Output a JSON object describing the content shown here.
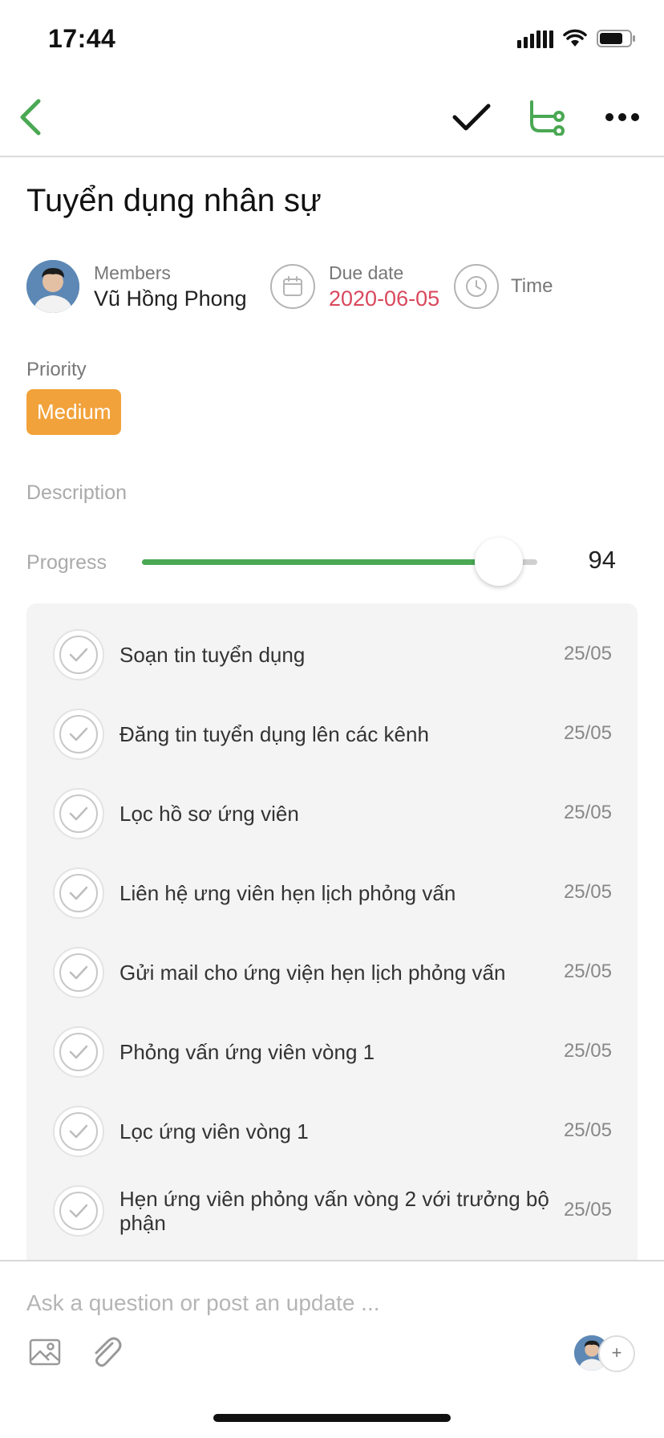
{
  "status_bar": {
    "time": "17:44"
  },
  "task": {
    "title": "Tuyển dụng nhân sự",
    "members_label": "Members",
    "member_name": "Vũ Hồng Phong",
    "due_label": "Due date",
    "due_value": "2020-06-05",
    "time_label": "Time",
    "priority_label": "Priority",
    "priority_value": "Medium",
    "description_label": "Description",
    "progress_label": "Progress",
    "progress_value": 94
  },
  "checklist": [
    {
      "text": "Soạn tin tuyển dụng",
      "date": "25/05"
    },
    {
      "text": "Đăng tin tuyển dụng lên các kênh",
      "date": "25/05"
    },
    {
      "text": "Lọc hồ sơ ứng viên",
      "date": "25/05"
    },
    {
      "text": "Liên hệ ưng viên hẹn lịch phỏng vấn",
      "date": "25/05"
    },
    {
      "text": "Gửi mail cho ứng viện hẹn lịch phỏng vấn",
      "date": "25/05"
    },
    {
      "text": "Phỏng vấn ứng viên vòng 1",
      "date": "25/05"
    },
    {
      "text": "Lọc ứng viên vòng 1",
      "date": "25/05"
    },
    {
      "text": "Hẹn ứng viên phỏng vấn vòng 2 với trưởng bộ phận",
      "date": "25/05"
    }
  ],
  "composer": {
    "placeholder": "Ask a question or post an update ...",
    "add_label": "+"
  },
  "colors": {
    "accent": "#4aa853",
    "due_date": "#d9485d",
    "priority_medium": "#f2a23b"
  },
  "icons": {
    "back": "chevron-left-icon",
    "complete": "check-icon",
    "subtasks": "subtask-tree-icon",
    "more": "more-horizontal-icon",
    "due": "calendar-icon",
    "time": "clock-icon",
    "image": "image-icon",
    "attach": "paperclip-icon"
  }
}
